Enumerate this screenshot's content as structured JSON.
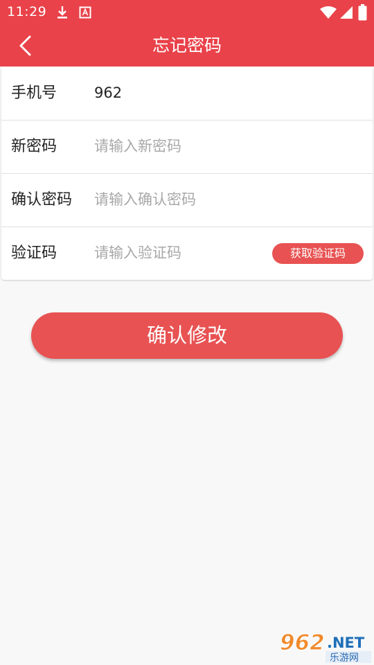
{
  "status_bar": {
    "time": "11:29",
    "left_icons": [
      "download-icon",
      "keyboard-a-icon"
    ],
    "right_icons": [
      "wifi-icon",
      "signal-icon",
      "battery-icon"
    ]
  },
  "header": {
    "title": "忘记密码",
    "back_icon": "chevron-left-icon",
    "bg_color": "#e9424a"
  },
  "form": {
    "phone": {
      "label": "手机号",
      "value": "962"
    },
    "new_password": {
      "label": "新密码",
      "placeholder": "请输入新密码"
    },
    "confirm_password": {
      "label": "确认密码",
      "placeholder": "请输入确认密码"
    },
    "code": {
      "label": "验证码",
      "placeholder": "请输入验证码",
      "button": "获取验证码"
    }
  },
  "actions": {
    "confirm": "确认修改",
    "accent": "#e85252"
  },
  "watermark": {
    "number": "962",
    "domain": ".NET",
    "name": "乐游网"
  }
}
